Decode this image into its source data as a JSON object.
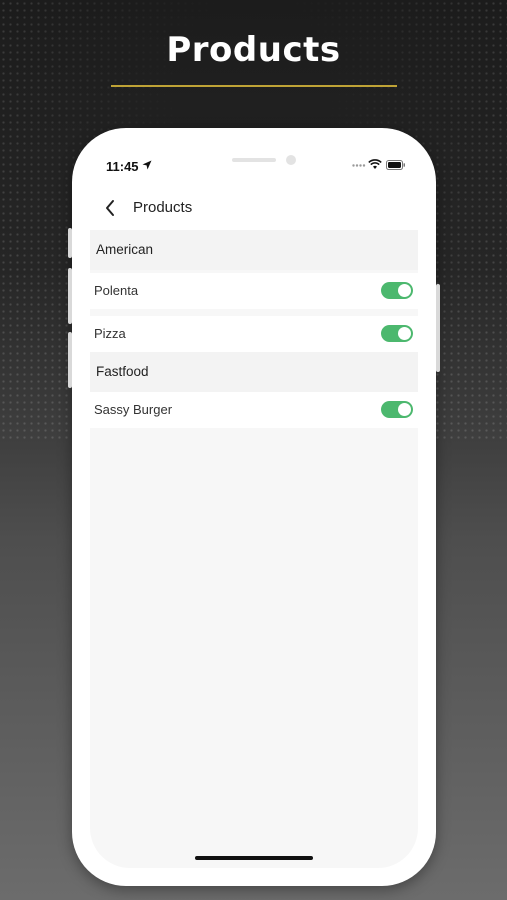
{
  "headline": "Products",
  "colors": {
    "accent_rule": "#bfa336",
    "toggle_on": "#4cb86e",
    "section_bg": "#f3f3f3",
    "list_bg": "#f7f7f7"
  },
  "status_bar": {
    "time": "11:45",
    "icons": [
      "location-arrow-icon",
      "signal-dots-icon",
      "wifi-icon",
      "battery-icon"
    ]
  },
  "nav": {
    "back_icon": "chevron-left-icon",
    "title": "Products"
  },
  "sections": [
    {
      "title": "American",
      "items": [
        {
          "label": "Polenta",
          "enabled": true
        },
        {
          "label": "Pizza",
          "enabled": true
        }
      ]
    },
    {
      "title": "Fastfood",
      "items": [
        {
          "label": "Sassy Burger",
          "enabled": true
        }
      ]
    }
  ]
}
